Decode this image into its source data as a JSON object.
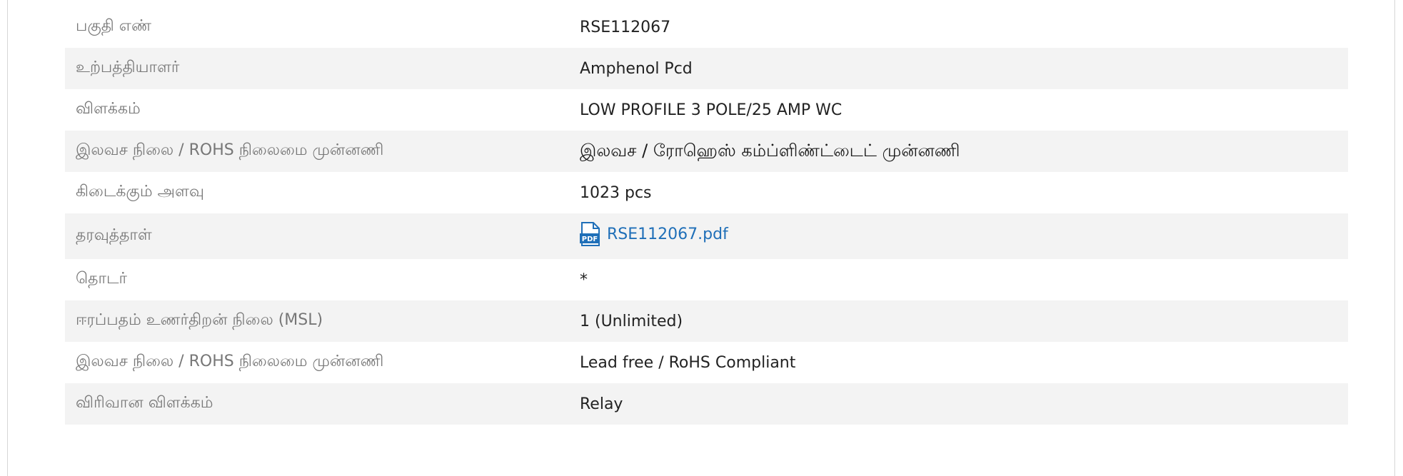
{
  "rows": [
    {
      "label": "பகுதி எண்",
      "value": "RSE112067"
    },
    {
      "label": "உற்பத்தியாளர்",
      "value": "Amphenol Pcd"
    },
    {
      "label": "விளக்கம்",
      "value": "LOW PROFILE 3 POLE/25 AMP WC"
    },
    {
      "label": "இலவச நிலை / ROHS நிலைமை முன்னணி",
      "value": "இலவச / ரோஹெஸ் கம்ப்ளிண்ட்டைட் முன்னணி"
    },
    {
      "label": "கிடைக்கும் அளவு",
      "value": "1023 pcs"
    },
    {
      "label": "தரவுத்தாள்",
      "value": "RSE112067.pdf",
      "icon": "pdf-file-icon"
    },
    {
      "label": "தொடர்",
      "value": "*"
    },
    {
      "label": "ஈரப்பதம் உணர்திறன் நிலை (MSL)",
      "value": "1 (Unlimited)"
    },
    {
      "label": "இலவச நிலை / ROHS நிலைமை முன்னணி",
      "value": "Lead free / RoHS Compliant"
    },
    {
      "label": "விரிவான விளக்கம்",
      "value": "Relay"
    }
  ],
  "colors": {
    "row_stripe": "#f3f3f3",
    "label_text": "#777777",
    "value_text": "#222222",
    "link": "#1f6fb8"
  }
}
